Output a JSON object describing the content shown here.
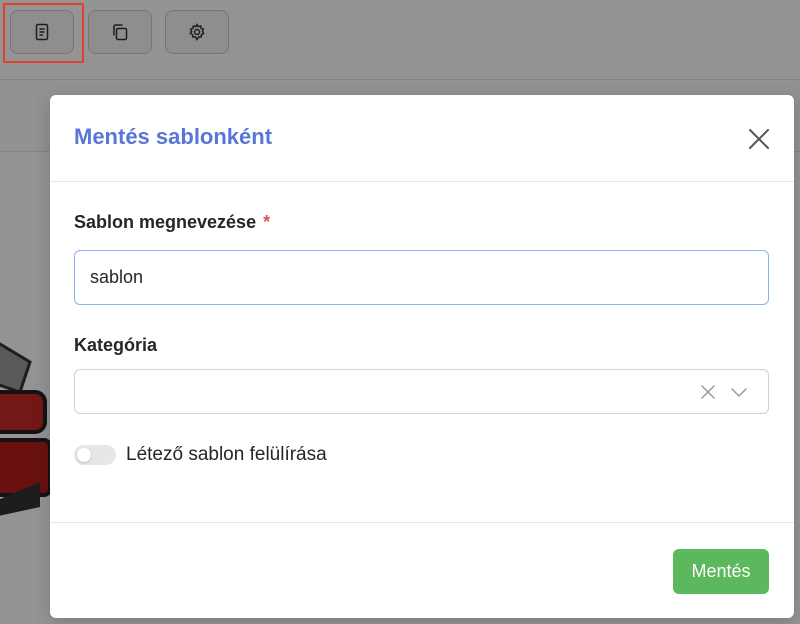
{
  "modal": {
    "title": "Mentés sablonként",
    "name_field": {
      "label": "Sablon megnevezése",
      "required_mark": "*",
      "value": "sablon",
      "placeholder": ""
    },
    "category_field": {
      "label": "Kategória",
      "value": ""
    },
    "overwrite_toggle": {
      "label": "Létező sablon felülírása",
      "checked": false
    },
    "save_label": "Mentés"
  },
  "toolbar": {
    "buttons": [
      {
        "icon": "document-icon"
      },
      {
        "icon": "copy-icon"
      },
      {
        "icon": "gear-icon"
      }
    ]
  },
  "colors": {
    "title": "#5a75d8",
    "save_button": "#5cb85c",
    "required": "#d9534f",
    "input_focus_border": "#8fb2ee",
    "highlight": "#e0412c"
  }
}
